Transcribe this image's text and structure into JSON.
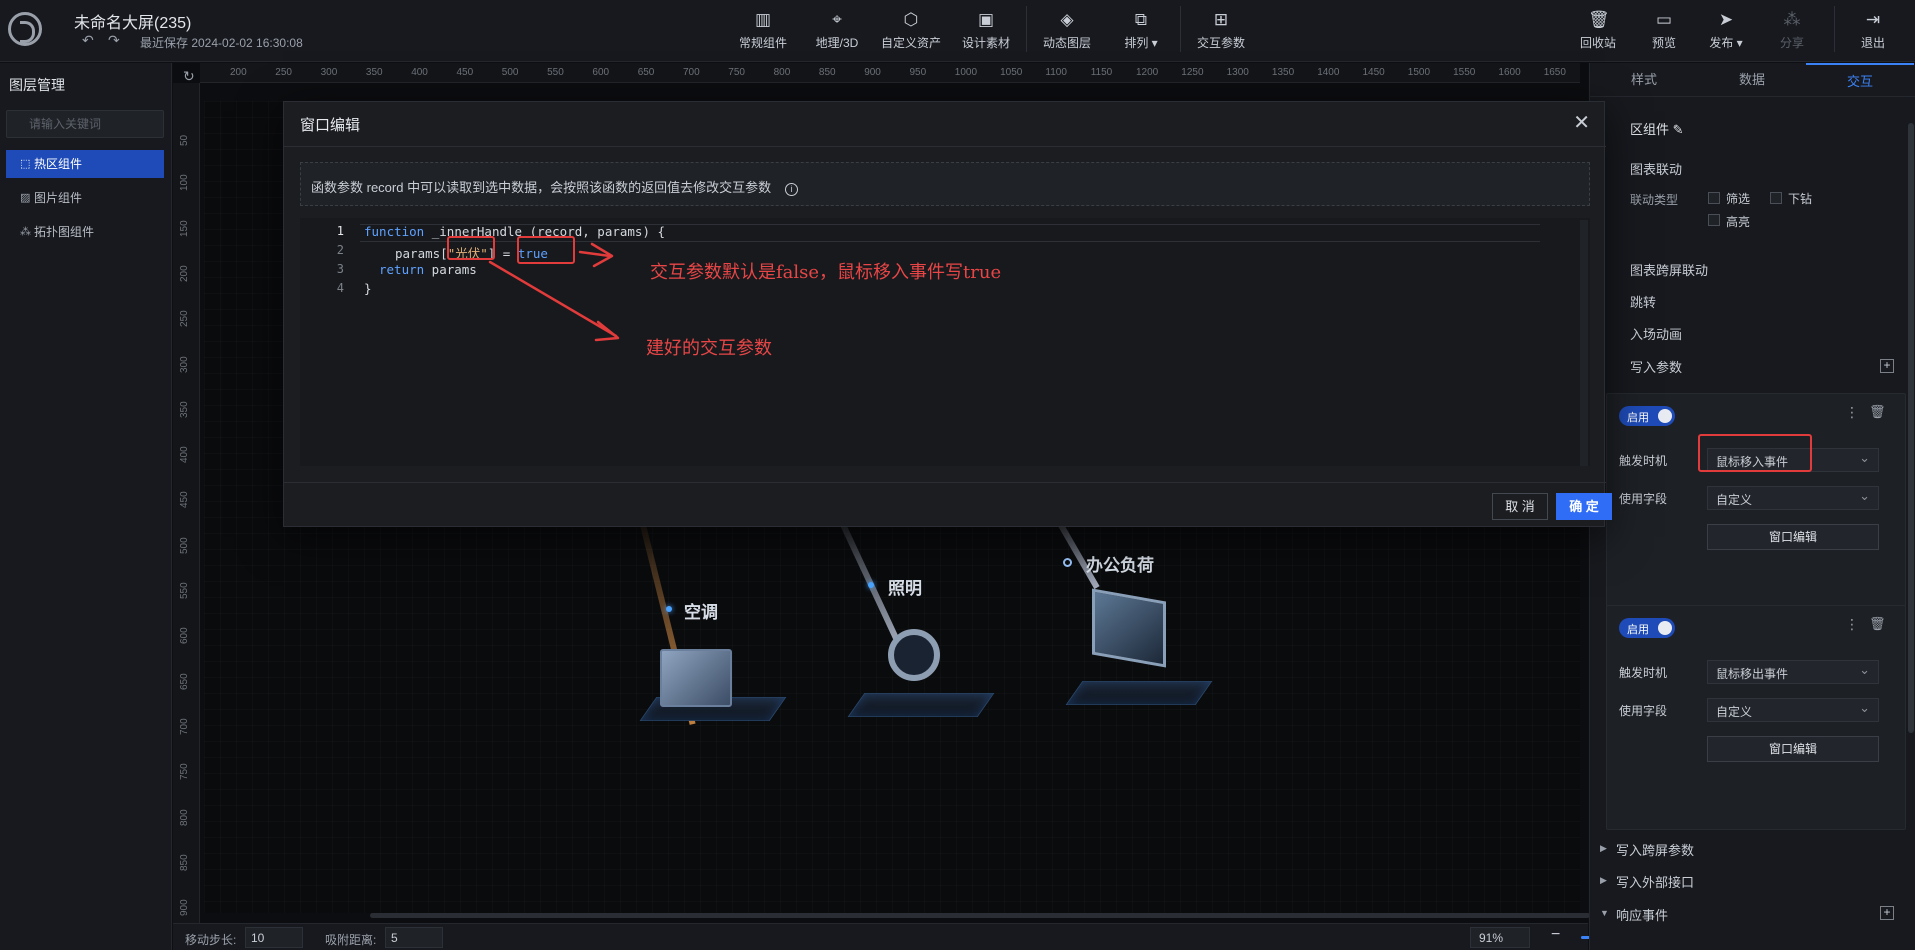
{
  "header": {
    "title": "未命名大屏(235)",
    "save_time": "最近保存 2024-02-02 16:30:08",
    "undo_icon": "undo-icon",
    "redo_icon": "redo-icon",
    "tools": [
      {
        "label": "常规组件",
        "icon": "bar-chart-icon"
      },
      {
        "label": "地理/3D",
        "icon": "map-pin-icon"
      },
      {
        "label": "自定义资产",
        "icon": "hexagon-icon"
      },
      {
        "label": "设计素材",
        "icon": "image-add-icon"
      },
      {
        "label": "动态图层",
        "icon": "layers-icon"
      },
      {
        "label": "排列",
        "icon": "copy-icon"
      },
      {
        "label": "交互参数",
        "icon": "sliders-icon"
      }
    ],
    "right_tools": [
      {
        "label": "回收站",
        "icon": "trash-icon"
      },
      {
        "label": "预览",
        "icon": "monitor-icon"
      },
      {
        "label": "发布",
        "icon": "send-icon"
      },
      {
        "label": "分享",
        "icon": "share-icon"
      },
      {
        "label": "退出",
        "icon": "exit-icon"
      }
    ]
  },
  "layers": {
    "title": "图层管理",
    "search_placeholder": "请输入关键词",
    "items": [
      {
        "label": "热区组件",
        "active": true
      },
      {
        "label": "图片组件",
        "active": false
      },
      {
        "label": "拓扑图组件",
        "active": false
      }
    ]
  },
  "ruler": {
    "top": [
      "200",
      "250",
      "300",
      "350",
      "400",
      "450",
      "500",
      "550",
      "600",
      "650",
      "700",
      "750",
      "800",
      "850",
      "900",
      "950",
      "1000",
      "1050",
      "1100",
      "1150",
      "1200",
      "1250",
      "1300",
      "1350",
      "1400",
      "1450",
      "1500",
      "1550",
      "1600",
      "1650"
    ],
    "left": [
      "50",
      "100",
      "150",
      "200",
      "250",
      "300",
      "350",
      "400",
      "450",
      "500",
      "550",
      "600",
      "650",
      "700",
      "750",
      "800",
      "850",
      "900"
    ]
  },
  "scene": {
    "labels": [
      "空调",
      "照明",
      "办公负荷"
    ]
  },
  "bottombar": {
    "step_label": "移动步长:",
    "step_value": "10",
    "snap_label": "吸附距离:",
    "snap_value": "5",
    "zoom": "91%",
    "zoom_fraction": 0.38
  },
  "modal": {
    "title": "窗口编辑",
    "notice": "函数参数 record 中可以读取到选中数据，会按照该函数的返回值去修改交互参数",
    "code": {
      "line_numbers": [
        "1",
        "2",
        "3",
        "4"
      ],
      "l1_kw": "function",
      "l1_rest": " _innerHandle (record, params) {",
      "l2_a": "params[",
      "l2_str": "\"光伏\"",
      "l2_b": "] = ",
      "l2_val": "true",
      "l3_kw": "return",
      "l3_rest": " params",
      "l4": "}"
    },
    "cancel": "取 消",
    "ok": "确 定"
  },
  "annotations": {
    "note1": "交互参数默认是false，鼠标移入事件写true",
    "note2": "建好的交互参数",
    "color": "#e23b3b"
  },
  "right_panel": {
    "tabs": [
      "样式",
      "数据",
      "交互"
    ],
    "active_tab": "交互",
    "component_title": "区组件",
    "section_link": "图表联动",
    "link_type_label": "联动类型",
    "opt_filter": "筛选",
    "opt_drill": "下钻",
    "opt_highlight": "高亮",
    "section_cross": "图表跨屏联动",
    "section_jump": "跳转",
    "section_anim": "入场动画",
    "section_write": "写入参数",
    "cards": [
      {
        "toggle": "启用",
        "trigger_label": "触发时机",
        "trigger": "鼠标移入事件",
        "field_label": "使用字段",
        "field": "自定义",
        "edit": "窗口编辑"
      },
      {
        "toggle": "启用",
        "trigger_label": "触发时机",
        "trigger": "鼠标移出事件",
        "field_label": "使用字段",
        "field": "自定义",
        "edit": "窗口编辑"
      }
    ],
    "section_write_cross": "写入跨屏参数",
    "section_write_ext": "写入外部接口",
    "section_response": "响应事件"
  }
}
